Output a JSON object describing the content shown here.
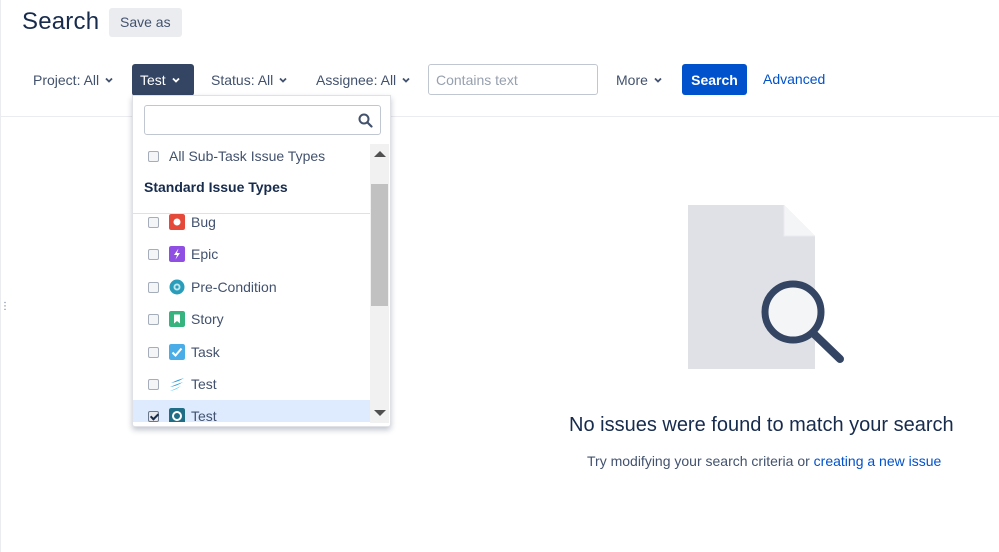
{
  "header": {
    "title": "Search",
    "save_as_label": "Save as"
  },
  "filters": {
    "project_label": "Project: All",
    "type_label": "Test",
    "status_label": "Status: All",
    "assignee_label": "Assignee: All",
    "text_placeholder": "Contains text",
    "more_label": "More",
    "search_button": "Search",
    "advanced_link": "Advanced"
  },
  "type_dropdown": {
    "search_value": "",
    "subtask_label": "All Sub-Task Issue Types",
    "group_heading": "Standard Issue Types",
    "items": [
      {
        "label": "Bug",
        "icon": "bug-icon",
        "color": "#e5493a",
        "checked": false
      },
      {
        "label": "Epic",
        "icon": "epic-icon",
        "color": "#904ee2",
        "checked": false
      },
      {
        "label": "Pre-Condition",
        "icon": "pre-condition-icon",
        "color": "#2a9dba",
        "checked": false
      },
      {
        "label": "Story",
        "icon": "story-icon",
        "color": "#36b37e",
        "checked": false
      },
      {
        "label": "Task",
        "icon": "task-icon",
        "color": "#4bade8",
        "checked": false
      },
      {
        "label": "Test",
        "icon": "xray-test-icon",
        "color": "#2d9cdb",
        "checked": false
      },
      {
        "label": "Test",
        "icon": "zephyr-test-icon",
        "color": "#1f6e86",
        "checked": true
      }
    ]
  },
  "empty_state": {
    "title": "No issues were found to match your search",
    "message_prefix": "Try modifying your search criteria or ",
    "create_link": "creating a new issue"
  },
  "colors": {
    "primary": "#0052cc",
    "active_filter": "#344563",
    "text": "#172b4d"
  }
}
